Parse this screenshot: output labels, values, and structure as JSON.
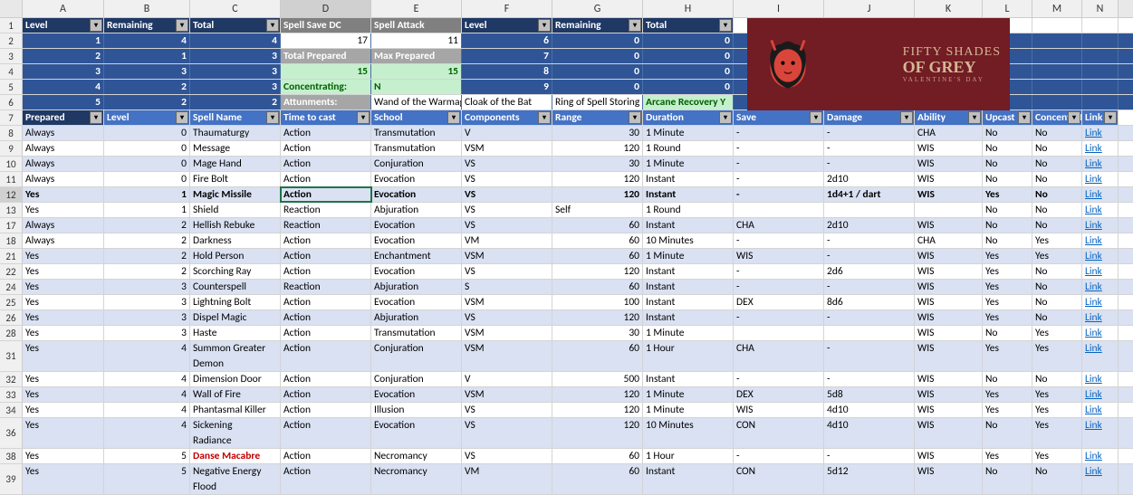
{
  "columns": [
    "A",
    "B",
    "C",
    "D",
    "E",
    "F",
    "G",
    "H",
    "I",
    "J",
    "K",
    "L",
    "M",
    "N"
  ],
  "top_headers": {
    "r1": {
      "A": "Level",
      "B": "Remaining",
      "C": "Total",
      "D": "Spell Save DC",
      "E": "Spell Attack",
      "F": "Level",
      "G": "Remaining",
      "H": "Total"
    },
    "r2": {
      "A": "1",
      "B": "4",
      "C": "4",
      "D": "17",
      "E": "11",
      "F": "6",
      "G": "0",
      "H": "0"
    },
    "r3": {
      "A": "2",
      "B": "1",
      "C": "3",
      "D": "Total Prepared",
      "E": "Max Prepared",
      "F": "7",
      "G": "0",
      "H": "0"
    },
    "r4": {
      "A": "3",
      "B": "3",
      "C": "3",
      "D": "15",
      "E": "15",
      "F": "8",
      "G": "0",
      "H": "0"
    },
    "r5": {
      "A": "4",
      "B": "2",
      "C": "3",
      "D": "Concentrating:",
      "E": "N",
      "F": "9",
      "G": "0",
      "H": "0"
    },
    "r6": {
      "A": "5",
      "B": "2",
      "C": "2",
      "D": "Attunments:",
      "E": "Wand of the Warmage",
      "F": "Cloak of the Bat",
      "G": "Ring of Spell Storing",
      "H": "Arcane Recovery Y"
    }
  },
  "table_headers": {
    "A": "Prepared",
    "B": "Level",
    "C": "Spell Name",
    "D": "Time to cast",
    "E": "School",
    "F": "Components",
    "G": "Range",
    "H": "Duration",
    "I": "Save",
    "J": "Damage",
    "K": "Ability",
    "L": "Upcast",
    "M": "Concentration",
    "N": "Link"
  },
  "rows": [
    {
      "rn": 8,
      "alt": 0,
      "A": "Always",
      "B": "0",
      "C": "Thaumaturgy",
      "D": "Action",
      "E": "Transmutation",
      "F": "V",
      "G": "30",
      "H": "1 Minute",
      "I": "-",
      "J": "-",
      "K": "CHA",
      "L": "No",
      "M": "No",
      "N": "Link"
    },
    {
      "rn": 9,
      "alt": 1,
      "A": "Always",
      "B": "0",
      "C": "Message",
      "D": "Action",
      "E": "Transmutation",
      "F": "VSM",
      "G": "120",
      "H": "1 Round",
      "I": "-",
      "J": "-",
      "K": "WIS",
      "L": "No",
      "M": "No",
      "N": "Link"
    },
    {
      "rn": 10,
      "alt": 0,
      "A": "Always",
      "B": "0",
      "C": "Mage Hand",
      "D": "Action",
      "E": "Conjuration",
      "F": "VS",
      "G": "30",
      "H": "1 Minute",
      "I": "-",
      "J": "-",
      "K": "WIS",
      "L": "No",
      "M": "No",
      "N": "Link"
    },
    {
      "rn": 11,
      "alt": 1,
      "A": "Always",
      "B": "0",
      "C": "Fire Bolt",
      "D": "Action",
      "E": "Evocation",
      "F": "VS",
      "G": "120",
      "H": "Instant",
      "I": "-",
      "J": "2d10",
      "K": "WIS",
      "L": "No",
      "M": "No",
      "N": "Link"
    },
    {
      "rn": 12,
      "alt": 0,
      "A": "Yes",
      "B": "1",
      "C": "Magic Missile",
      "D": "Action",
      "E": "Evocation",
      "F": "VS",
      "G": "120",
      "H": "Instant",
      "I": "-",
      "J": "1d4+1 / dart",
      "K": "WIS",
      "L": "Yes",
      "M": "No",
      "N": "Link",
      "active": true,
      "bold": true
    },
    {
      "rn": 13,
      "alt": 1,
      "A": "Yes",
      "B": "1",
      "C": "Shield",
      "D": "Reaction",
      "E": "Abjuration",
      "F": "VS",
      "G": "Self",
      "H": "1 Round",
      "I": "",
      "J": "",
      "K": "",
      "L": "No",
      "M": "No",
      "N": "Link"
    },
    {
      "rn": 17,
      "alt": 0,
      "A": "Always",
      "B": "2",
      "C": "Hellish Rebuke",
      "D": "Reaction",
      "E": "Evocation",
      "F": "VS",
      "G": "60",
      "H": "Instant",
      "I": "CHA",
      "J": "2d10",
      "K": "WIS",
      "L": "No",
      "M": "No",
      "N": "Link"
    },
    {
      "rn": 18,
      "alt": 1,
      "A": "Always",
      "B": "2",
      "C": "Darkness",
      "D": "Action",
      "E": "Evocation",
      "F": "VM",
      "G": "60",
      "H": "10 Minutes",
      "I": "-",
      "J": "-",
      "K": "CHA",
      "L": "No",
      "M": "Yes",
      "N": "Link"
    },
    {
      "rn": 21,
      "alt": 0,
      "A": "Yes",
      "B": "2",
      "C": "Hold Person",
      "D": "Action",
      "E": "Enchantment",
      "F": "VSM",
      "G": "60",
      "H": "1 Minute",
      "I": "WIS",
      "J": "-",
      "K": "WIS",
      "L": "Yes",
      "M": "Yes",
      "N": "Link"
    },
    {
      "rn": 22,
      "alt": 1,
      "A": "Yes",
      "B": "2",
      "C": "Scorching Ray",
      "D": "Action",
      "E": "Evocation",
      "F": "VS",
      "G": "120",
      "H": "Instant",
      "I": "-",
      "J": "2d6",
      "K": "WIS",
      "L": "Yes",
      "M": "No",
      "N": "Link"
    },
    {
      "rn": 24,
      "alt": 0,
      "A": "Yes",
      "B": "3",
      "C": "Counterspell",
      "D": "Reaction",
      "E": "Abjuration",
      "F": "S",
      "G": "60",
      "H": "Instant",
      "I": "-",
      "J": "-",
      "K": "WIS",
      "L": "Yes",
      "M": "No",
      "N": "Link"
    },
    {
      "rn": 25,
      "alt": 1,
      "A": "Yes",
      "B": "3",
      "C": "Lightning Bolt",
      "D": "Action",
      "E": "Evocation",
      "F": "VSM",
      "G": "100",
      "H": "Instant",
      "I": "DEX",
      "J": "8d6",
      "K": "WIS",
      "L": "Yes",
      "M": "No",
      "N": "Link"
    },
    {
      "rn": 26,
      "alt": 0,
      "A": "Yes",
      "B": "3",
      "C": "Dispel Magic",
      "D": "Action",
      "E": "Abjuration",
      "F": "VS",
      "G": "120",
      "H": "Instant",
      "I": "-",
      "J": "-",
      "K": "WIS",
      "L": "Yes",
      "M": "No",
      "N": "Link"
    },
    {
      "rn": 28,
      "alt": 1,
      "A": "Yes",
      "B": "3",
      "C": "Haste",
      "D": "Action",
      "E": "Transmutation",
      "F": "VSM",
      "G": "30",
      "H": "1 Minute",
      "I": "",
      "J": "",
      "K": "WIS",
      "L": "No",
      "M": "Yes",
      "N": "Link"
    },
    {
      "rn": 31,
      "alt": 0,
      "A": "Yes",
      "B": "4",
      "C": "Summon Greater Demon",
      "D": "Action",
      "E": "Conjuration",
      "F": "VSM",
      "G": "60",
      "H": "1 Hour",
      "I": "CHA",
      "J": "-",
      "K": "WIS",
      "L": "Yes",
      "M": "Yes",
      "N": "Link",
      "tall": true
    },
    {
      "rn": 32,
      "alt": 1,
      "A": "Yes",
      "B": "4",
      "C": "Dimension Door",
      "D": "Action",
      "E": "Conjuration",
      "F": "V",
      "G": "500",
      "H": "Instant",
      "I": "-",
      "J": "-",
      "K": "WIS",
      "L": "No",
      "M": "No",
      "N": "Link"
    },
    {
      "rn": 33,
      "alt": 0,
      "A": "Yes",
      "B": "4",
      "C": "Wall of Fire",
      "D": "Action",
      "E": "Evocation",
      "F": "VSM",
      "G": "120",
      "H": "1 Minute",
      "I": "DEX",
      "J": "5d8",
      "K": "WIS",
      "L": "Yes",
      "M": "Yes",
      "N": "Link"
    },
    {
      "rn": 34,
      "alt": 1,
      "A": "Yes",
      "B": "4",
      "C": "Phantasmal Killer",
      "D": "Action",
      "E": "Illusion",
      "F": "VS",
      "G": "120",
      "H": "1 Minute",
      "I": "WIS",
      "J": "4d10",
      "K": "WIS",
      "L": "Yes",
      "M": "Yes",
      "N": "Link"
    },
    {
      "rn": 36,
      "alt": 0,
      "A": "Yes",
      "B": "4",
      "C": "Sickening Radiance",
      "D": "Action",
      "E": "Evocation",
      "F": "VS",
      "G": "120",
      "H": "10 Minutes",
      "I": "CON",
      "J": "4d10",
      "K": "WIS",
      "L": "No",
      "M": "Yes",
      "N": "Link",
      "tall": true
    },
    {
      "rn": 38,
      "alt": 1,
      "A": "Yes",
      "B": "5",
      "C": "Danse Macabre",
      "D": "Action",
      "E": "Necromancy",
      "F": "VS",
      "G": "60",
      "H": "1 Hour",
      "I": "-",
      "J": "-",
      "K": "WIS",
      "L": "Yes",
      "M": "Yes",
      "N": "Link",
      "red": true
    },
    {
      "rn": 39,
      "alt": 0,
      "A": "Yes",
      "B": "5",
      "C": "Negative Energy Flood",
      "D": "Action",
      "E": "Necromancy",
      "F": "VM",
      "G": "60",
      "H": "Instant",
      "I": "CON",
      "J": "5d12",
      "K": "WIS",
      "L": "No",
      "M": "No",
      "N": "Link",
      "tall": true
    }
  ],
  "image_text": {
    "l1": "FIFTY SHADES",
    "l2": "OF GREY",
    "l3": "VALENTINE'S DAY"
  }
}
